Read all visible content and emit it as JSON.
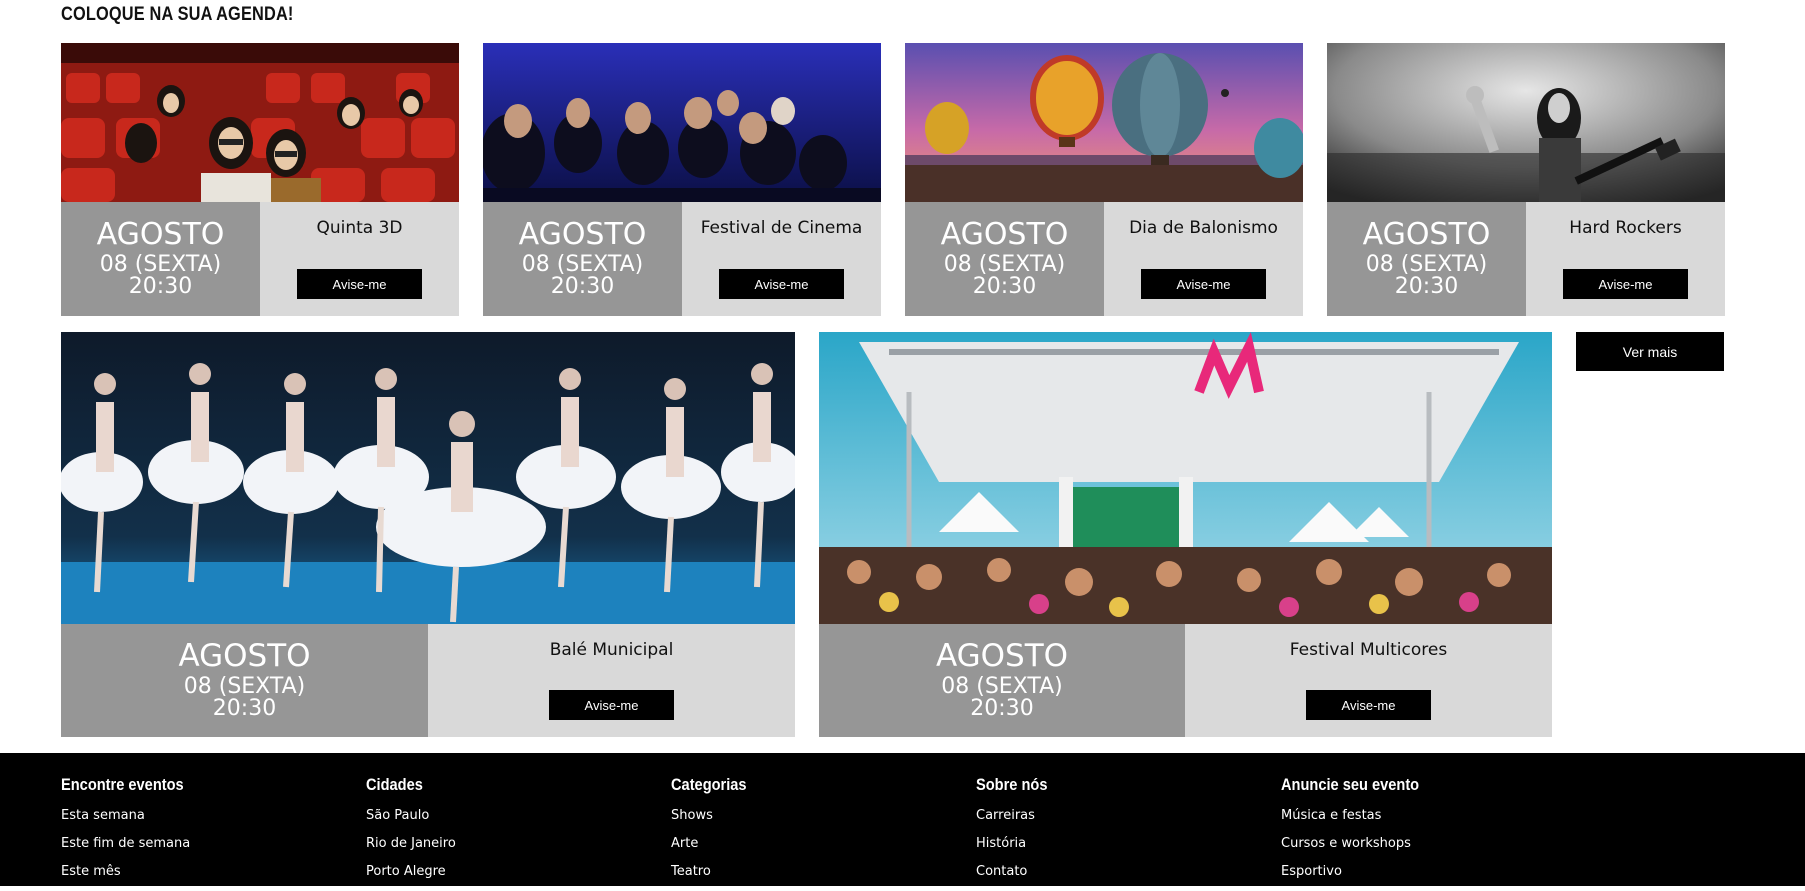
{
  "section": {
    "title": "COLOQUE NA SUA AGENDA!"
  },
  "events": [
    {
      "month": "AGOSTO",
      "day": "08 (SEXTA)",
      "time": "20:30",
      "name": "Quinta 3D",
      "cta": "Avise-me"
    },
    {
      "month": "AGOSTO",
      "day": "08 (SEXTA)",
      "time": "20:30",
      "name": "Festival de Cinema",
      "cta": "Avise-me"
    },
    {
      "month": "AGOSTO",
      "day": "08 (SEXTA)",
      "time": "20:30",
      "name": "Dia de Balonismo",
      "cta": "Avise-me"
    },
    {
      "month": "AGOSTO",
      "day": "08 (SEXTA)",
      "time": "20:30",
      "name": "Hard Rockers",
      "cta": "Avise-me"
    },
    {
      "month": "AGOSTO",
      "day": "08 (SEXTA)",
      "time": "20:30",
      "name": "Balé Municipal",
      "cta": "Avise-me"
    },
    {
      "month": "AGOSTO",
      "day": "08 (SEXTA)",
      "time": "20:30",
      "name": "Festival Multicores",
      "cta": "Avise-me"
    }
  ],
  "see_more": "Ver mais",
  "footer": {
    "columns": [
      {
        "title": "Encontre eventos",
        "links": [
          "Esta semana",
          "Este fim de semana",
          "Este mês"
        ]
      },
      {
        "title": "Cidades",
        "links": [
          "São Paulo",
          "Rio de Janeiro",
          "Porto Alegre"
        ]
      },
      {
        "title": "Categorias",
        "links": [
          "Shows",
          "Arte",
          "Teatro"
        ]
      },
      {
        "title": "Sobre nós",
        "links": [
          "Carreiras",
          "História",
          "Contato"
        ]
      },
      {
        "title": "Anuncie seu evento",
        "links": [
          "Música e festas",
          "Cursos e workshops",
          "Esportivo"
        ]
      }
    ]
  },
  "colors": {
    "date_panel": "#969696",
    "info_panel": "#d9d9d9",
    "button": "#000000",
    "footer": "#000000"
  }
}
